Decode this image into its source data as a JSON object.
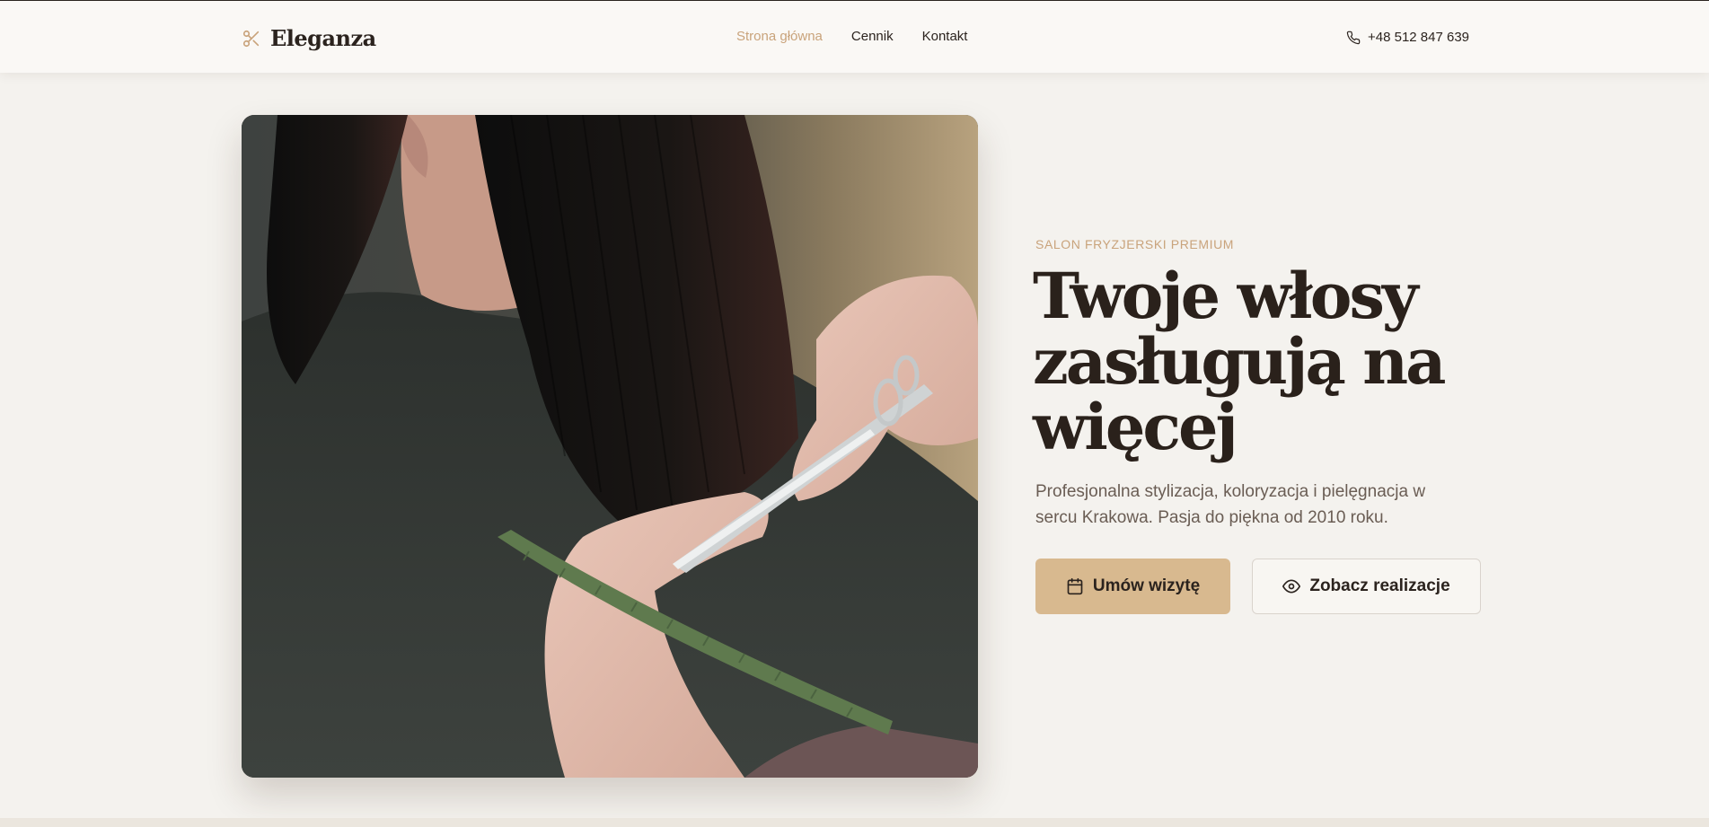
{
  "header": {
    "brand": "Eleganza",
    "nav": [
      {
        "label": "Strona główna",
        "active": true
      },
      {
        "label": "Cennik",
        "active": false
      },
      {
        "label": "Kontakt",
        "active": false
      }
    ],
    "phone": "+48 512 847 639"
  },
  "hero": {
    "eyebrow": "SALON FRYZJERSKI PREMIUM",
    "title_lines": [
      "Twoje włosy",
      "zasługują na",
      "więcej"
    ],
    "description": "Profesjonalna stylizacja, koloryzacja i pielęgnacja w sercu Krakowa. Pasja do piękna od 2010 roku.",
    "primary_button": "Umów wizytę",
    "secondary_button": "Zobacz realizacje"
  },
  "icons": {
    "logo": "scissors-icon",
    "phone": "phone-icon",
    "primary_button": "calendar-icon",
    "secondary_button": "eye-icon"
  },
  "colors": {
    "accent": "#c9a37b",
    "primary_button": "#d8b98f",
    "text_dark": "#2a211b",
    "text_muted": "#6a5d54",
    "background": "#f4f2ee"
  }
}
